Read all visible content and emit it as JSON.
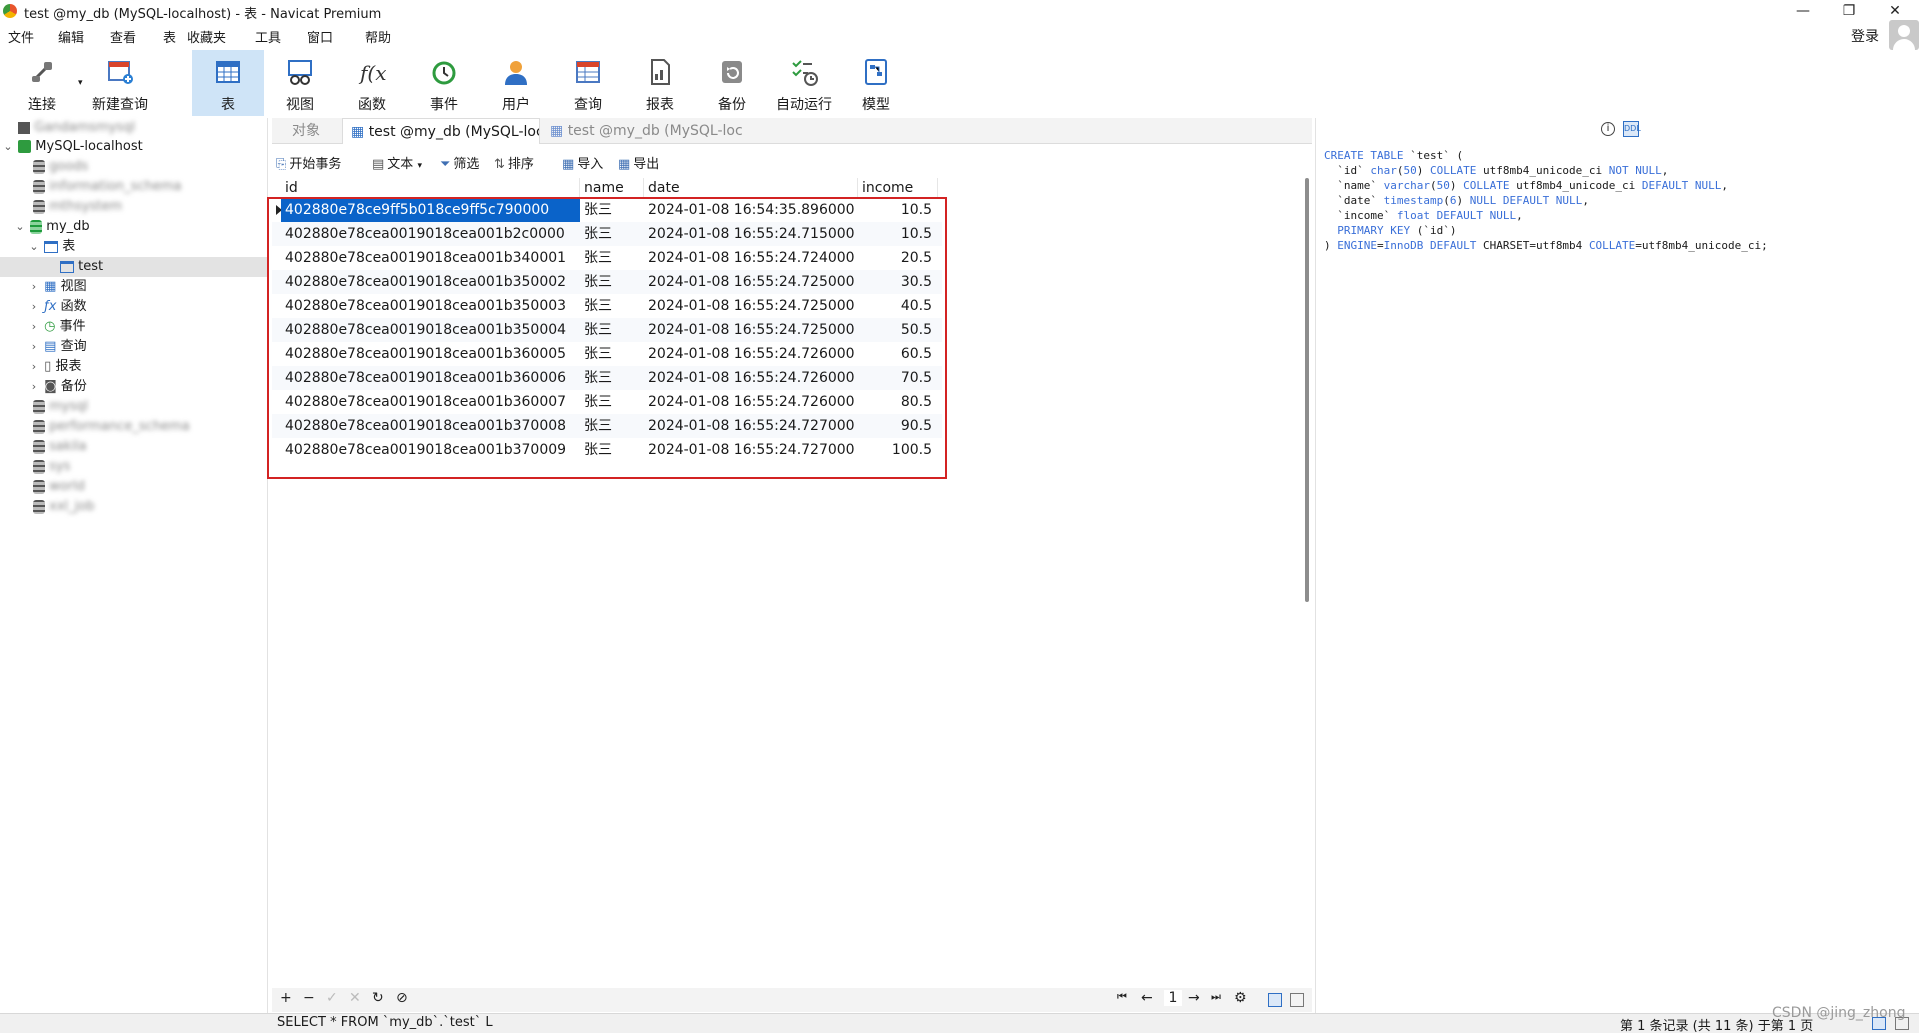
{
  "window": {
    "title": "test @my_db (MySQL-localhost) - 表 - Navicat Premium",
    "controls": [
      "—",
      "❐",
      "✕"
    ]
  },
  "menu": [
    "文件",
    "编辑",
    "查看",
    "表",
    "收藏夹",
    "工具",
    "窗口",
    "帮助"
  ],
  "account": {
    "login": "登录"
  },
  "toolbar": [
    {
      "label": "连接",
      "icon": "connect-icon"
    },
    {
      "label": "新建查询",
      "icon": "new-query-icon"
    },
    {
      "label": "表",
      "icon": "table-icon",
      "active": true
    },
    {
      "label": "视图",
      "icon": "view-icon"
    },
    {
      "label": "函数",
      "icon": "function-icon"
    },
    {
      "label": "事件",
      "icon": "event-icon"
    },
    {
      "label": "用户",
      "icon": "user-icon"
    },
    {
      "label": "查询",
      "icon": "query-icon"
    },
    {
      "label": "报表",
      "icon": "report-icon"
    },
    {
      "label": "备份",
      "icon": "backup-icon"
    },
    {
      "label": "自动运行",
      "icon": "automation-icon"
    },
    {
      "label": "模型",
      "icon": "model-icon"
    }
  ],
  "tree": {
    "connection_blurred": "Gandamsmysql",
    "connection": "MySQL-localhost",
    "databases_before": [
      "goods",
      "information_schema",
      "mthsystem"
    ],
    "open_db": "my_db",
    "tables_folder": "表",
    "selected_table": "test",
    "folders": [
      {
        "label": "视图",
        "icon": "view-icon"
      },
      {
        "label": "函数",
        "icon": "function-icon"
      },
      {
        "label": "事件",
        "icon": "event-icon"
      },
      {
        "label": "查询",
        "icon": "query-icon"
      },
      {
        "label": "报表",
        "icon": "report-icon"
      },
      {
        "label": "备份",
        "icon": "backup-icon"
      }
    ],
    "databases_after": [
      "mysql",
      "performance_schema",
      "sakila",
      "sys",
      "world",
      "xxl_job"
    ]
  },
  "tabs": [
    {
      "label": "对象"
    },
    {
      "label": "test @my_db (MySQL-loc..."
    },
    {
      "label": "test @my_db (MySQL-loc..."
    }
  ],
  "data_toolbar": {
    "begin_txn": "开始事务",
    "text": "文本",
    "filter": "筛选",
    "sort": "排序",
    "import": "导入",
    "export": "导出"
  },
  "grid": {
    "columns": [
      "id",
      "name",
      "date",
      "income"
    ],
    "rows": [
      [
        "402880e78ce9ff5b018ce9ff5c790000",
        "张三",
        "2024-01-08 16:54:35.896000",
        "10.5"
      ],
      [
        "402880e78cea0019018cea001b2c0000",
        "张三",
        "2024-01-08 16:55:24.715000",
        "10.5"
      ],
      [
        "402880e78cea0019018cea001b340001",
        "张三",
        "2024-01-08 16:55:24.724000",
        "20.5"
      ],
      [
        "402880e78cea0019018cea001b350002",
        "张三",
        "2024-01-08 16:55:24.725000",
        "30.5"
      ],
      [
        "402880e78cea0019018cea001b350003",
        "张三",
        "2024-01-08 16:55:24.725000",
        "40.5"
      ],
      [
        "402880e78cea0019018cea001b350004",
        "张三",
        "2024-01-08 16:55:24.725000",
        "50.5"
      ],
      [
        "402880e78cea0019018cea001b360005",
        "张三",
        "2024-01-08 16:55:24.726000",
        "60.5"
      ],
      [
        "402880e78cea0019018cea001b360006",
        "张三",
        "2024-01-08 16:55:24.726000",
        "70.5"
      ],
      [
        "402880e78cea0019018cea001b360007",
        "张三",
        "2024-01-08 16:55:24.726000",
        "80.5"
      ],
      [
        "402880e78cea0019018cea001b370008",
        "张三",
        "2024-01-08 16:55:24.727000",
        "90.5"
      ],
      [
        "402880e78cea0019018cea001b370009",
        "张三",
        "2024-01-08 16:55:24.727000",
        "100.5"
      ]
    ]
  },
  "bottom": {
    "add": "+",
    "remove": "−",
    "apply": "✓",
    "discard": "✕",
    "refresh": "↻",
    "stop": "⊘",
    "first": "⏮",
    "prev": "←",
    "page": "1",
    "next": "→",
    "last": "⏭",
    "settings": "⚙"
  },
  "status": {
    "sql": "SELECT * FROM `my_db`.`test` L",
    "records": "第 1 条记录 (共 11 条) 于第 1 页"
  },
  "watermark": "CSDN @jing_zhong",
  "ddl": {
    "lines": [
      "CREATE TABLE `test` (",
      "  `id` char(50) COLLATE utf8mb4_unicode_ci NOT NULL,",
      "  `name` varchar(50) COLLATE utf8mb4_unicode_ci DEFAULT NULL,",
      "  `date` timestamp(6) NULL DEFAULT NULL,",
      "  `income` float DEFAULT NULL,",
      "  PRIMARY KEY (`id`)",
      ") ENGINE=InnoDB DEFAULT CHARSET=utf8mb4 COLLATE=utf8mb4_unicode_ci;"
    ]
  },
  "colors": {
    "accent": "#0a63c9",
    "highlight_box": "#d32323",
    "active_tool": "#cfe4f7"
  }
}
